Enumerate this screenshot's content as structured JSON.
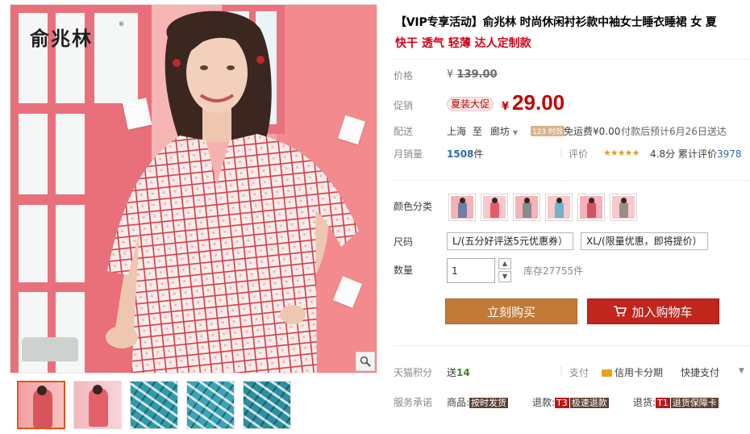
{
  "gallery": {
    "brand_logo": "俞兆林",
    "brand_mark": "®",
    "zoom_icon": "magnifier-icon",
    "thumbnails": [
      {
        "name": "thumb-model-front"
      },
      {
        "name": "thumb-model-standing"
      },
      {
        "name": "thumb-fabric-detail-1"
      },
      {
        "name": "thumb-fabric-detail-2"
      },
      {
        "name": "thumb-fabric-detail-3"
      }
    ]
  },
  "product": {
    "title": "【VIP专享活动】俞兆林 时尚休闲衬衫款中袖女士睡衣睡裙 女 夏",
    "subtitle": "快干 透气 轻薄 达人定制款",
    "price_label": "价格",
    "original_price_symbol": "¥",
    "original_price": "139.00",
    "promo_label": "促销",
    "promo_tag": "夏装大促",
    "price_symbol": "¥",
    "current_price": "29.00",
    "shipping_label": "配送",
    "ship_from": "上海",
    "ship_to_word": "至",
    "ship_dest": "廊坊",
    "timing_badge": "123 时效",
    "shipping_fee": "免运费¥0.00",
    "ship_estimate": "付款后预计6月26日送达",
    "sales_label": "月销量",
    "sales_count": "1508",
    "sales_unit": "件",
    "review_label": "评价",
    "rating_stars": "★★★★★",
    "rating_score": "4.8分",
    "cumulative_label": "累计评价",
    "cumulative_count": "3978"
  },
  "options": {
    "color_label": "颜色分类",
    "colors": [
      {
        "name": "color-1",
        "dress": "#6e7ea6"
      },
      {
        "name": "color-2",
        "dress": "#e45b66"
      },
      {
        "name": "color-3",
        "dress": "#8a8a8a"
      },
      {
        "name": "color-4",
        "dress": "#6fb4c9"
      },
      {
        "name": "color-5",
        "dress": "#d85060"
      },
      {
        "name": "color-6",
        "dress": "#9a8d89"
      }
    ],
    "size_label": "尺码",
    "sizes": [
      "L/(五分好评送5元优惠券）",
      "XL/(限量优惠，即将提价）"
    ],
    "qty_label": "数量",
    "qty_value": "1",
    "stock_text": "库存27755件"
  },
  "actions": {
    "buy_now": "立刻购买",
    "add_to_cart": "加入购物车"
  },
  "services": {
    "points_label": "天猫积分",
    "points_prefix": "送",
    "points_value": "14",
    "pay_label": "支付",
    "credit_card": "信用卡分期",
    "quick_pay": "快捷支付",
    "promise_label": "服务承诺",
    "goods_prefix": "商品:",
    "goods_tag": "按时发货",
    "refund_prefix": "退款:",
    "refund_badge": "T3",
    "refund_tag": "极速退款",
    "return_prefix": "退货:",
    "return_badge": "T1",
    "return_tag": "退货保障卡"
  },
  "colors_theme": {
    "price_red": "#c40000",
    "buy_btn": "#c17938",
    "cart_btn": "#c1261d"
  }
}
